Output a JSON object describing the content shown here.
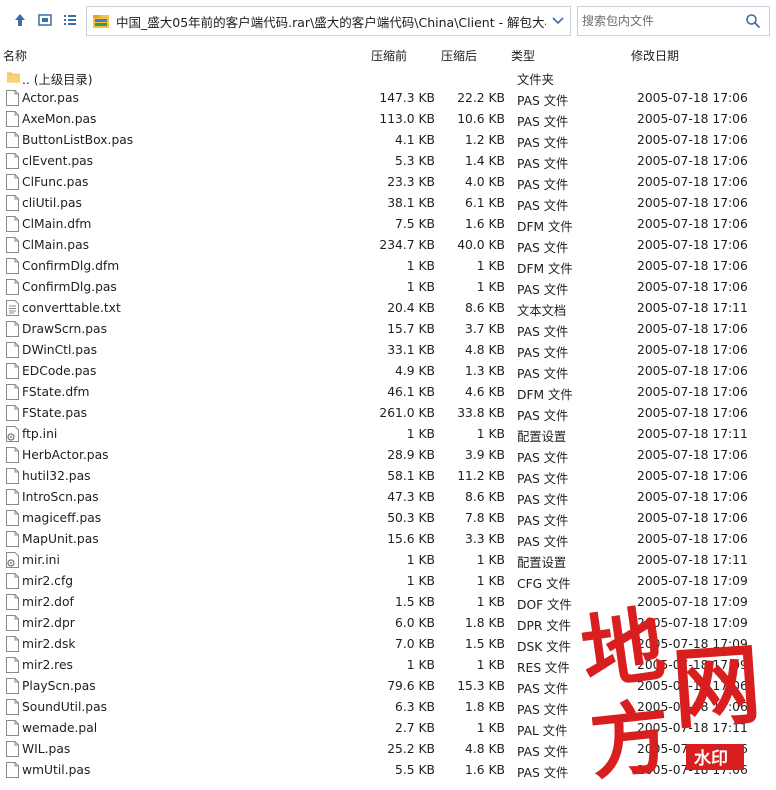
{
  "toolbar": {
    "back_icon": "arrow-up-icon",
    "view_icon": "view-icon",
    "list_icon": "list-icon",
    "address_path": "中国_盛大05年前的客户端代码.rar\\盛大的客户端代码\\China\\Client - 解包大小为",
    "search_placeholder": "搜索包内文件"
  },
  "columns": {
    "name": "名称",
    "original": "压缩前",
    "compressed": "压缩后",
    "type": "类型",
    "modified": "修改日期"
  },
  "files": [
    {
      "icon": "folder",
      "name": ".. (上级目录)",
      "original": "",
      "compressed": "",
      "type": "文件夹",
      "date": ""
    },
    {
      "icon": "file",
      "name": "Actor.pas",
      "original": "147.3 KB",
      "compressed": "22.2 KB",
      "type": "PAS 文件",
      "date": "2005-07-18 17:06"
    },
    {
      "icon": "file",
      "name": "AxeMon.pas",
      "original": "113.0 KB",
      "compressed": "10.6 KB",
      "type": "PAS 文件",
      "date": "2005-07-18 17:06"
    },
    {
      "icon": "file",
      "name": "ButtonListBox.pas",
      "original": "4.1 KB",
      "compressed": "1.2 KB",
      "type": "PAS 文件",
      "date": "2005-07-18 17:06"
    },
    {
      "icon": "file",
      "name": "clEvent.pas",
      "original": "5.3 KB",
      "compressed": "1.4 KB",
      "type": "PAS 文件",
      "date": "2005-07-18 17:06"
    },
    {
      "icon": "file",
      "name": "ClFunc.pas",
      "original": "23.3 KB",
      "compressed": "4.0 KB",
      "type": "PAS 文件",
      "date": "2005-07-18 17:06"
    },
    {
      "icon": "file",
      "name": "cliUtil.pas",
      "original": "38.1 KB",
      "compressed": "6.1 KB",
      "type": "PAS 文件",
      "date": "2005-07-18 17:06"
    },
    {
      "icon": "file",
      "name": "ClMain.dfm",
      "original": "7.5 KB",
      "compressed": "1.6 KB",
      "type": "DFM 文件",
      "date": "2005-07-18 17:06"
    },
    {
      "icon": "file",
      "name": "ClMain.pas",
      "original": "234.7 KB",
      "compressed": "40.0 KB",
      "type": "PAS 文件",
      "date": "2005-07-18 17:06"
    },
    {
      "icon": "file",
      "name": "ConfirmDlg.dfm",
      "original": "1 KB",
      "compressed": "1 KB",
      "type": "DFM 文件",
      "date": "2005-07-18 17:06"
    },
    {
      "icon": "file",
      "name": "ConfirmDlg.pas",
      "original": "1 KB",
      "compressed": "1 KB",
      "type": "PAS 文件",
      "date": "2005-07-18 17:06"
    },
    {
      "icon": "text",
      "name": "converttable.txt",
      "original": "20.4 KB",
      "compressed": "8.6 KB",
      "type": "文本文档",
      "date": "2005-07-18 17:11"
    },
    {
      "icon": "file",
      "name": "DrawScrn.pas",
      "original": "15.7 KB",
      "compressed": "3.7 KB",
      "type": "PAS 文件",
      "date": "2005-07-18 17:06"
    },
    {
      "icon": "file",
      "name": "DWinCtl.pas",
      "original": "33.1 KB",
      "compressed": "4.8 KB",
      "type": "PAS 文件",
      "date": "2005-07-18 17:06"
    },
    {
      "icon": "file",
      "name": "EDCode.pas",
      "original": "4.9 KB",
      "compressed": "1.3 KB",
      "type": "PAS 文件",
      "date": "2005-07-18 17:06"
    },
    {
      "icon": "file",
      "name": "FState.dfm",
      "original": "46.1 KB",
      "compressed": "4.6 KB",
      "type": "DFM 文件",
      "date": "2005-07-18 17:06"
    },
    {
      "icon": "file",
      "name": "FState.pas",
      "original": "261.0 KB",
      "compressed": "33.8 KB",
      "type": "PAS 文件",
      "date": "2005-07-18 17:06"
    },
    {
      "icon": "ini",
      "name": "ftp.ini",
      "original": "1 KB",
      "compressed": "1 KB",
      "type": "配置设置",
      "date": "2005-07-18 17:11"
    },
    {
      "icon": "file",
      "name": "HerbActor.pas",
      "original": "28.9 KB",
      "compressed": "3.9 KB",
      "type": "PAS 文件",
      "date": "2005-07-18 17:06"
    },
    {
      "icon": "file",
      "name": "hutil32.pas",
      "original": "58.1 KB",
      "compressed": "11.2 KB",
      "type": "PAS 文件",
      "date": "2005-07-18 17:06"
    },
    {
      "icon": "file",
      "name": "IntroScn.pas",
      "original": "47.3 KB",
      "compressed": "8.6 KB",
      "type": "PAS 文件",
      "date": "2005-07-18 17:06"
    },
    {
      "icon": "file",
      "name": "magiceff.pas",
      "original": "50.3 KB",
      "compressed": "7.8 KB",
      "type": "PAS 文件",
      "date": "2005-07-18 17:06"
    },
    {
      "icon": "file",
      "name": "MapUnit.pas",
      "original": "15.6 KB",
      "compressed": "3.3 KB",
      "type": "PAS 文件",
      "date": "2005-07-18 17:06"
    },
    {
      "icon": "ini",
      "name": "mir.ini",
      "original": "1 KB",
      "compressed": "1 KB",
      "type": "配置设置",
      "date": "2005-07-18 17:11"
    },
    {
      "icon": "file",
      "name": "mir2.cfg",
      "original": "1 KB",
      "compressed": "1 KB",
      "type": "CFG 文件",
      "date": "2005-07-18 17:09"
    },
    {
      "icon": "file",
      "name": "mir2.dof",
      "original": "1.5 KB",
      "compressed": "1 KB",
      "type": "DOF 文件",
      "date": "2005-07-18 17:09"
    },
    {
      "icon": "file",
      "name": "mir2.dpr",
      "original": "6.0 KB",
      "compressed": "1.8 KB",
      "type": "DPR 文件",
      "date": "2005-07-18 17:09"
    },
    {
      "icon": "file",
      "name": "mir2.dsk",
      "original": "7.0 KB",
      "compressed": "1.5 KB",
      "type": "DSK 文件",
      "date": "2005-07-18 17:09"
    },
    {
      "icon": "file",
      "name": "mir2.res",
      "original": "1 KB",
      "compressed": "1 KB",
      "type": "RES 文件",
      "date": "2005-07-18 17:09"
    },
    {
      "icon": "file",
      "name": "PlayScn.pas",
      "original": "79.6 KB",
      "compressed": "15.3 KB",
      "type": "PAS 文件",
      "date": "2005-07-18 17:06"
    },
    {
      "icon": "file",
      "name": "SoundUtil.pas",
      "original": "6.3 KB",
      "compressed": "1.8 KB",
      "type": "PAS 文件",
      "date": "2005-07-18 17:06"
    },
    {
      "icon": "file",
      "name": "wemade.pal",
      "original": "2.7 KB",
      "compressed": "1 KB",
      "type": "PAL 文件",
      "date": "2005-07-18 17:11"
    },
    {
      "icon": "file",
      "name": "WIL.pas",
      "original": "25.2 KB",
      "compressed": "4.8 KB",
      "type": "PAS 文件",
      "date": "2005-07-18 17:06"
    },
    {
      "icon": "file",
      "name": "wmUtil.pas",
      "original": "5.5 KB",
      "compressed": "1.6 KB",
      "type": "PAS 文件",
      "date": "2005-07-18 17:06"
    }
  ],
  "watermark": {
    "chars": [
      "地",
      "网",
      "方"
    ],
    "badge": "水印",
    "color": "#d81e1e"
  }
}
